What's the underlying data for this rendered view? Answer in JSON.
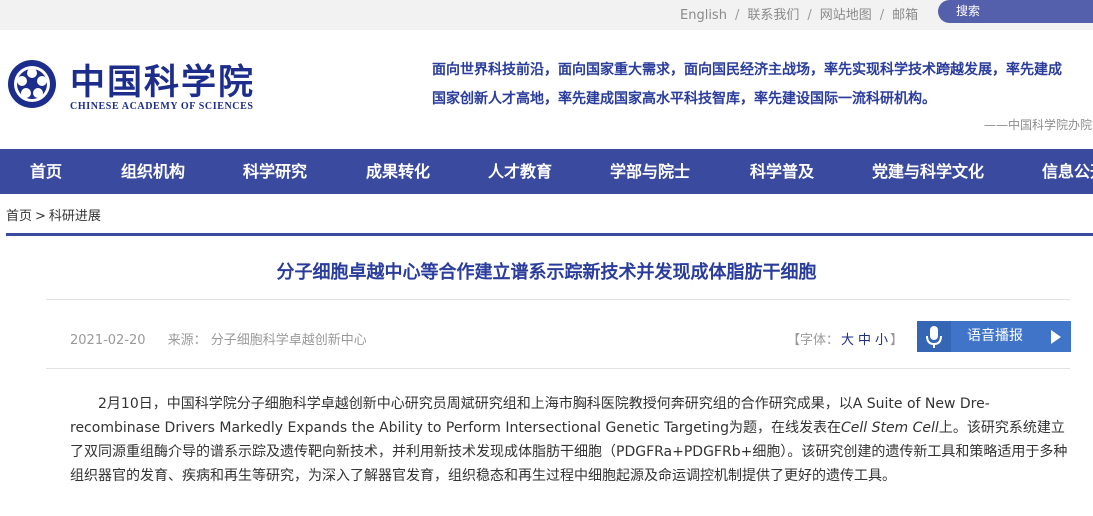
{
  "top_links": {
    "english": "English",
    "contact": "联系我们",
    "sitemap": "网站地图",
    "email": "邮箱",
    "separator": "/"
  },
  "search": {
    "label": "搜索"
  },
  "logo": {
    "cn": "中国科学院",
    "en": "CHINESE ACADEMY OF SCIENCES"
  },
  "slogan": {
    "line1": "面向世界科技前沿，面向国家重大需求，面向国民经济主战场，率先实现科学技术跨越发展，率先建成",
    "line2": "国家创新人才高地，率先建成国家高水平科技智库，率先建设国际一流科研机构。",
    "signature": "——中国科学院办院方针"
  },
  "nav": {
    "items": [
      "首页",
      "组织机构",
      "科学研究",
      "成果转化",
      "人才教育",
      "学部与院士",
      "科学普及",
      "党建与科学文化",
      "信息公开"
    ]
  },
  "breadcrumb": {
    "home": "首页",
    "sep": ">",
    "current": "科研进展"
  },
  "article": {
    "title": "分子细胞卓越中心等合作建立谱系示踪新技术并发现成体脂肪干细胞",
    "date": "2021-02-20",
    "source": "来源：  分子细胞科学卓越创新中心",
    "font_prefix": "【字体：",
    "font_large": "大",
    "font_medium": "中",
    "font_small": "小",
    "font_suffix": "】",
    "voice_label": "语音播报",
    "para_part1": "2月10日，中国科学院分子细胞科学卓越创新中心研究员周斌研究组和上海市胸科医院教授何奔研究组的合作研究成果，以A Suite of New Dre-recombinase Drivers Markedly Expands the Ability to Perform Intersectional Genetic Targeting为题，在线发表在",
    "para_journal": "Cell Stem Cell",
    "para_part2": "上。该研究系统建立了双同源重组酶介导的谱系示踪及遗传靶向新技术，并利用新技术发现成体脂肪干细胞（PDGFRa+PDGFRb+细胞）。该研究创建的遗传新工具和策略适用于多种组织器官的发育、疾病和再生等研究，为深入了解器官发育，组织稳态和再生过程中细胞起源及命运调控机制提供了更好的遗传工具。"
  },
  "colors": {
    "brand": "#3a4a9e",
    "logo": "#1d2d8c",
    "voice_button": "#3f74c8",
    "search_pill": "#5560ad"
  }
}
